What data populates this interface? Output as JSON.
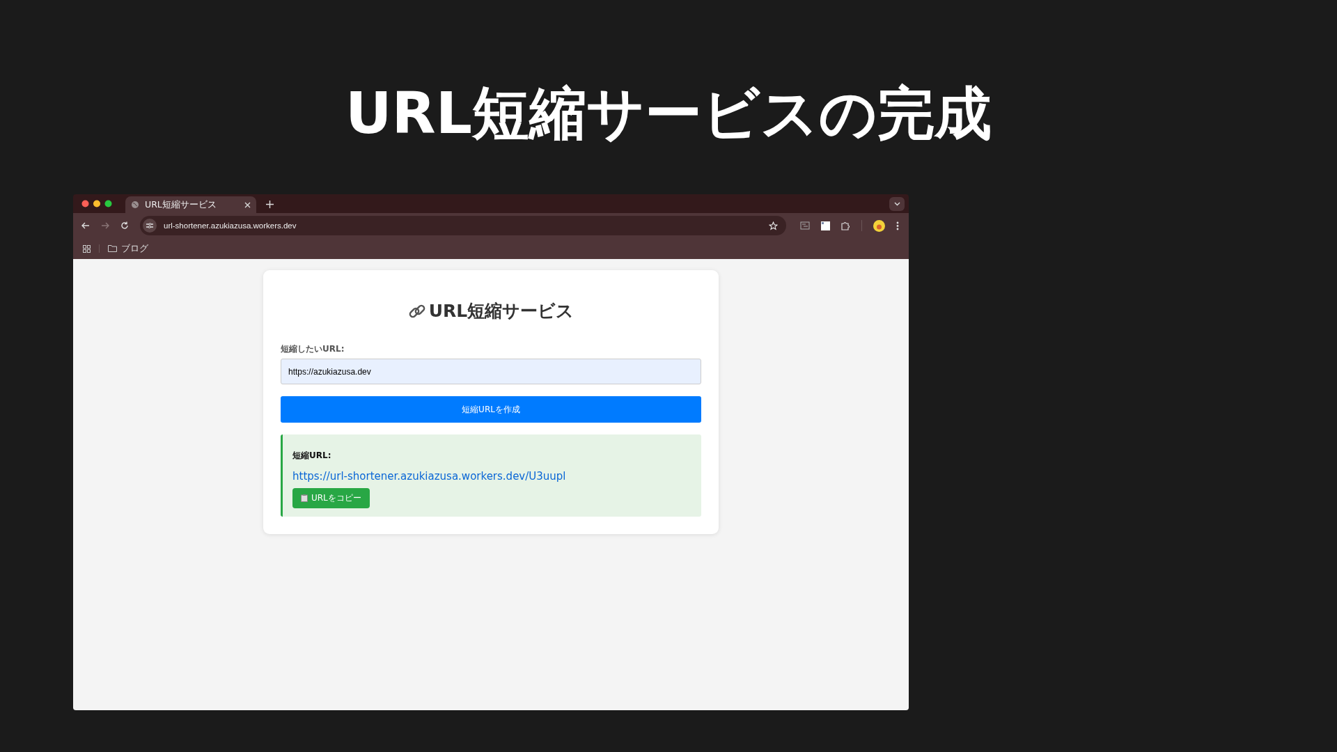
{
  "slide": {
    "title": "URL短縮サービスの完成"
  },
  "browser": {
    "tabs": [
      {
        "title": "URL短縮サービス",
        "selected": true
      }
    ],
    "address": "url-shortener.azukiazusa.workers.dev",
    "bookmarks": [
      {
        "label": "ブログ"
      }
    ]
  },
  "page": {
    "title": "URL短縮サービス",
    "input_label": "短縮したいURL:",
    "input_value": "https://azukiazusa.dev",
    "submit_button": "短縮URLを作成",
    "result": {
      "label": "短縮URL:",
      "link": "https://url-shortener.azukiazusa.workers.dev/U3uupl",
      "copy_button": "URLをコピー"
    }
  }
}
